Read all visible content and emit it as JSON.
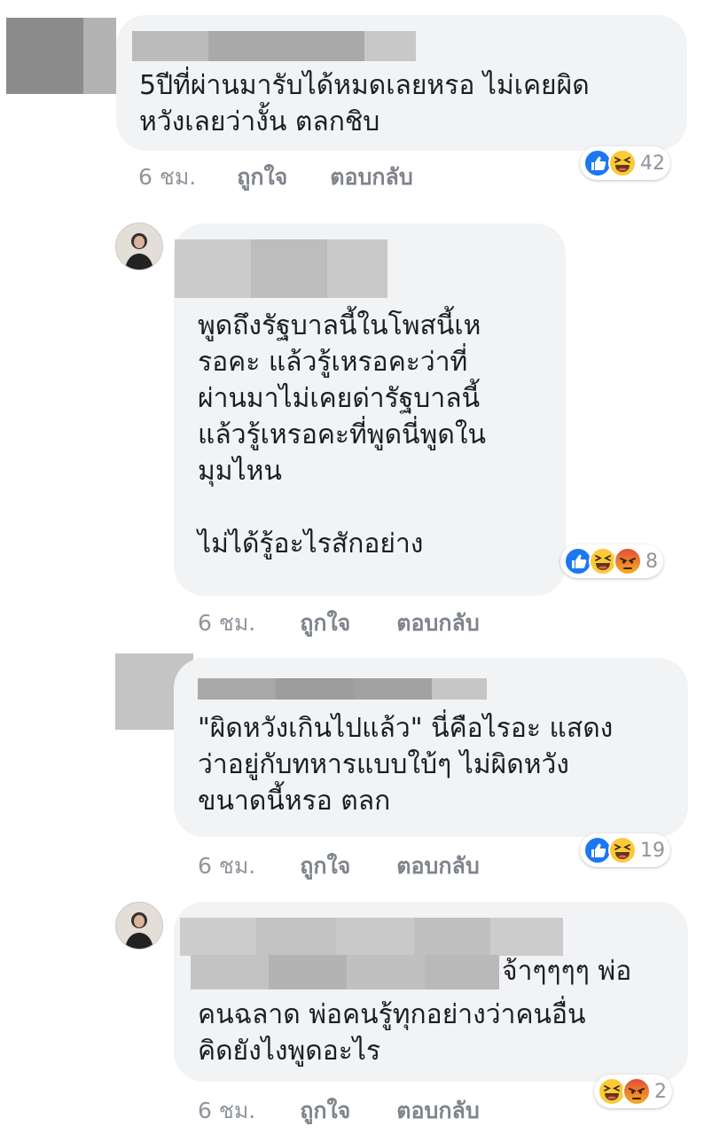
{
  "comments": [
    {
      "text": "5ปีที่ผ่านมารับได้หมดเลยหรอ ไม่เคยผิด\nหวังเลยว่างั้น ตลกชิบ",
      "time": "6 ชม.",
      "like_label": "ถูกใจ",
      "reply_label": "ตอบกลับ",
      "reactions": [
        "like-icon",
        "haha-icon"
      ],
      "reaction_count": "42"
    },
    {
      "text": "พูดถึงรัฐบาลนี้ในโพสนี้เห\nรอคะ แล้วรู้เหรอคะว่าที่\nผ่านมาไม่เคยด่ารัฐบาลนี้\nแล้วรู้เหรอคะที่พูดนี่พูดใน\nมุมไหน\n\nไม่ได้รู้อะไรสักอย่าง",
      "time": "6 ชม.",
      "like_label": "ถูกใจ",
      "reply_label": "ตอบกลับ",
      "reactions": [
        "like-icon",
        "haha-icon",
        "angry-icon"
      ],
      "reaction_count": "8"
    },
    {
      "text": "\"ผิดหวังเกินไปแล้ว\" นี่คือไรอะ แสดง\nว่าอยู่กับทหารแบบใบ้ๆ ไม่ผิดหวัง\nขนาดนี้หรอ ตลก",
      "time": "6 ชม.",
      "like_label": "ถูกใจ",
      "reply_label": "ตอบกลับ",
      "reactions": [
        "like-icon",
        "haha-icon"
      ],
      "reaction_count": "19"
    },
    {
      "text_first": "จ้าๆๆๆๆ พ่อ",
      "text_rest": "คนฉลาด พ่อคนรู้ทุกอย่างว่าคนอื่น\nคิดยังไงพูดอะไร",
      "time": "6 ชม.",
      "like_label": "ถูกใจ",
      "reply_label": "ตอบกลับ",
      "reactions": [
        "haha-icon",
        "angry-icon"
      ],
      "reaction_count": "2"
    }
  ],
  "colors": {
    "bubble": "#f2f3f5",
    "meta": "#90949c",
    "like": "#1877f2",
    "haha": "#fcc93a",
    "angry": "#e9710f"
  }
}
